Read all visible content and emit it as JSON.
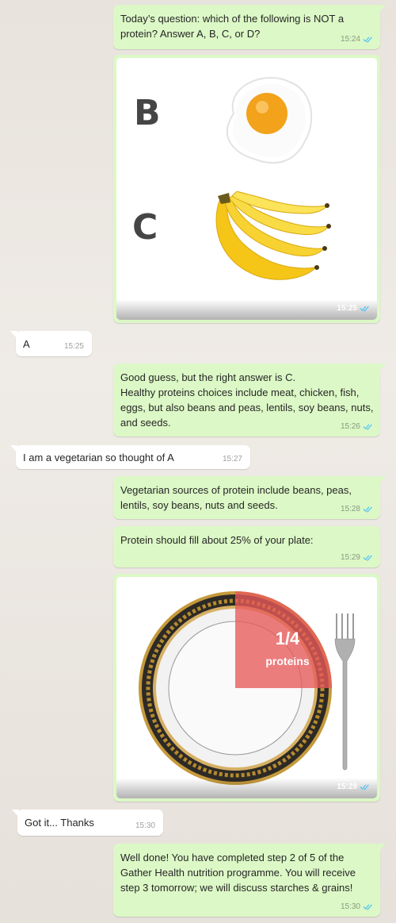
{
  "messages": [
    {
      "text": "Today’s question: which of the following is NOT a protein? Answer A, B, C, or D?",
      "time": "15:24"
    },
    {
      "time": "15:25",
      "image": {
        "letter_b": "B",
        "letter_c": "C"
      }
    },
    {
      "text": "A",
      "time": "15:25"
    },
    {
      "text": "Good guess, but the right answer is C.\nHealthy proteins choices include meat, chicken, fish, eggs, but also beans and peas, lentils, soy beans, nuts, and seeds.",
      "time": "15:26"
    },
    {
      "text": "I am a vegetarian so thought of A",
      "time": "15:27"
    },
    {
      "text": "Vegetarian sources of protein include beans, peas, lentils, soy beans, nuts and seeds.",
      "time": "15:28"
    },
    {
      "text": "Protein should fill about 25% of your plate:",
      "time": "15:29"
    },
    {
      "time": "15:29",
      "image": {
        "fraction": "1/4",
        "label": "proteins"
      }
    },
    {
      "text": "Got it... Thanks",
      "time": "15:30"
    },
    {
      "text": "Well done! You have completed step 2 of 5 of the Gather Health nutrition programme. You will receive step 3 tomorrow; we will discuss starches & grains!",
      "time": "15:30"
    }
  ],
  "colors": {
    "outgoing_bubble": "#dcf8c6",
    "incoming_bubble": "#ffffff",
    "read_tick": "#4fc3f7",
    "protein_overlay": "#e85a5a"
  },
  "icons": {
    "read_receipt": "double-check-icon"
  }
}
